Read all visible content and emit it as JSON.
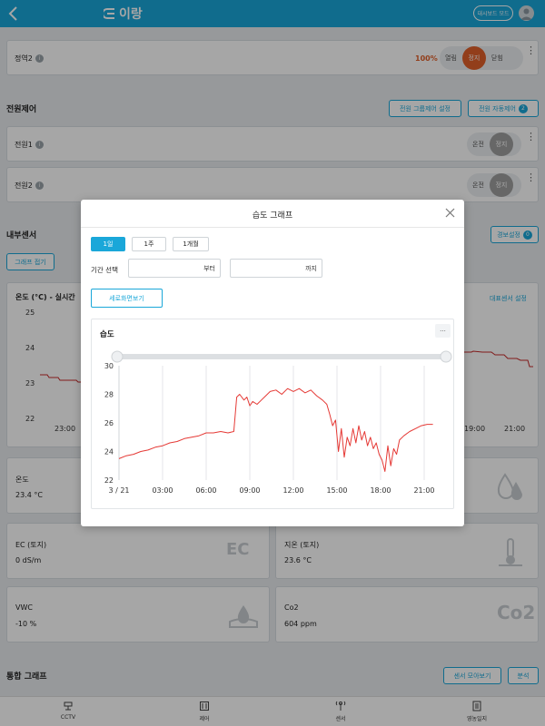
{
  "app": {
    "logo_text": "이랑",
    "dashboard_mode": "대시보드 모드"
  },
  "background": {
    "shade_row": {
      "label": "정역2",
      "percent": "100%",
      "open": "열림",
      "stop": "정지",
      "close": "닫힘"
    },
    "power_section": {
      "title": "전원제어",
      "group_setting": "전원 그룹제어 설정",
      "auto_control": "전원 자동제어",
      "auto_count": "2",
      "rows": [
        {
          "label": "전원1",
          "on": "온전",
          "stop": "정지"
        },
        {
          "label": "전원2",
          "on": "온전",
          "stop": "정지"
        }
      ]
    },
    "sensor_section": {
      "title": "내부센서",
      "alert_setting": "경보설정",
      "alert_count": "0",
      "fold_graph": "그래프 접기",
      "temp_graph_title": "온도 (°C) - 실시간",
      "rep_sensor": "대표센서 설정",
      "y_ticks": [
        "25",
        "24",
        "23",
        "22"
      ],
      "x_ticks_left": [
        "23:00"
      ],
      "x_ticks_right": [
        "19:00",
        "21:00"
      ]
    },
    "tiles": [
      {
        "name": "온도",
        "value": "23.4 °C"
      },
      {
        "name": "EC (토지)",
        "value": "0 dS/m",
        "icon": "EC"
      },
      {
        "name": "지온 (토지)",
        "value": "23.6 °C"
      },
      {
        "name": "VWC",
        "value": "-10 %"
      },
      {
        "name": "Co2",
        "value": "604 ppm",
        "icon": "Co2"
      }
    ],
    "combined_section": {
      "title": "통합 그래프",
      "sensor_view": "센서 모아보기",
      "analysis": "분석"
    }
  },
  "bottom_nav": [
    {
      "label": "CCTV"
    },
    {
      "label": "제어"
    },
    {
      "label": "센서"
    },
    {
      "label": "영농일지"
    }
  ],
  "modal": {
    "title": "습도 그래프",
    "periods": [
      "1일",
      "1주",
      "1개월"
    ],
    "active_period": "1일",
    "range_label": "기간 선택",
    "from_suffix": "부터",
    "to_suffix": "까지",
    "rotate_label": "세로화면보기",
    "menu_label": "···"
  },
  "chart_data": {
    "type": "line",
    "title": "습도",
    "ylim": [
      22,
      30
    ],
    "y_ticks": [
      22,
      24,
      26,
      28,
      30
    ],
    "x_tick_labels": [
      "3 / 21",
      "03:00",
      "06:00",
      "09:00",
      "12:00",
      "15:00",
      "18:00",
      "21:00"
    ],
    "x_hours": [
      0,
      3,
      6,
      9,
      12,
      15,
      18,
      21
    ],
    "xlim": [
      0,
      22
    ],
    "grid": "vertical",
    "color": "#e53935",
    "series": [
      {
        "x": [
          0,
          0.5,
          1,
          1.5,
          2,
          2.5,
          3,
          3.5,
          4,
          4.5,
          5,
          5.5,
          6,
          6.5,
          7,
          7.5,
          7.9,
          8.1,
          8.3,
          8.6,
          8.8,
          9.0,
          9.2,
          9.5,
          9.8,
          10.1,
          10.4,
          10.8,
          11.2,
          11.6,
          12.0,
          12.4,
          12.8,
          13.2,
          13.6,
          14.0,
          14.3,
          14.5,
          14.7,
          14.9,
          15.1,
          15.3,
          15.5,
          15.7,
          15.9,
          16.1,
          16.3,
          16.5,
          16.7,
          16.9,
          17.1,
          17.3,
          17.5,
          17.7,
          17.9,
          18.1,
          18.3,
          18.5,
          18.7,
          18.9,
          19.1,
          19.3,
          19.6,
          20.0,
          20.4,
          20.8,
          21.2,
          21.6
        ],
        "y": [
          23.5,
          23.7,
          23.8,
          24.0,
          24.1,
          24.3,
          24.4,
          24.6,
          24.7,
          24.9,
          25.0,
          25.1,
          25.3,
          25.3,
          25.4,
          25.3,
          25.4,
          27.8,
          28.0,
          27.6,
          27.8,
          27.2,
          27.5,
          27.3,
          27.6,
          27.9,
          28.2,
          28.3,
          28.0,
          28.4,
          28.2,
          28.4,
          28.1,
          28.3,
          27.9,
          27.6,
          27.3,
          26.6,
          25.8,
          26.2,
          24.0,
          25.6,
          23.6,
          25.0,
          24.4,
          25.6,
          24.6,
          25.8,
          24.8,
          25.4,
          24.4,
          25.0,
          24.2,
          24.6,
          23.8,
          23.4,
          22.6,
          24.4,
          23.0,
          24.2,
          23.8,
          24.8,
          25.1,
          25.4,
          25.6,
          25.8,
          25.9,
          25.9
        ]
      }
    ]
  }
}
